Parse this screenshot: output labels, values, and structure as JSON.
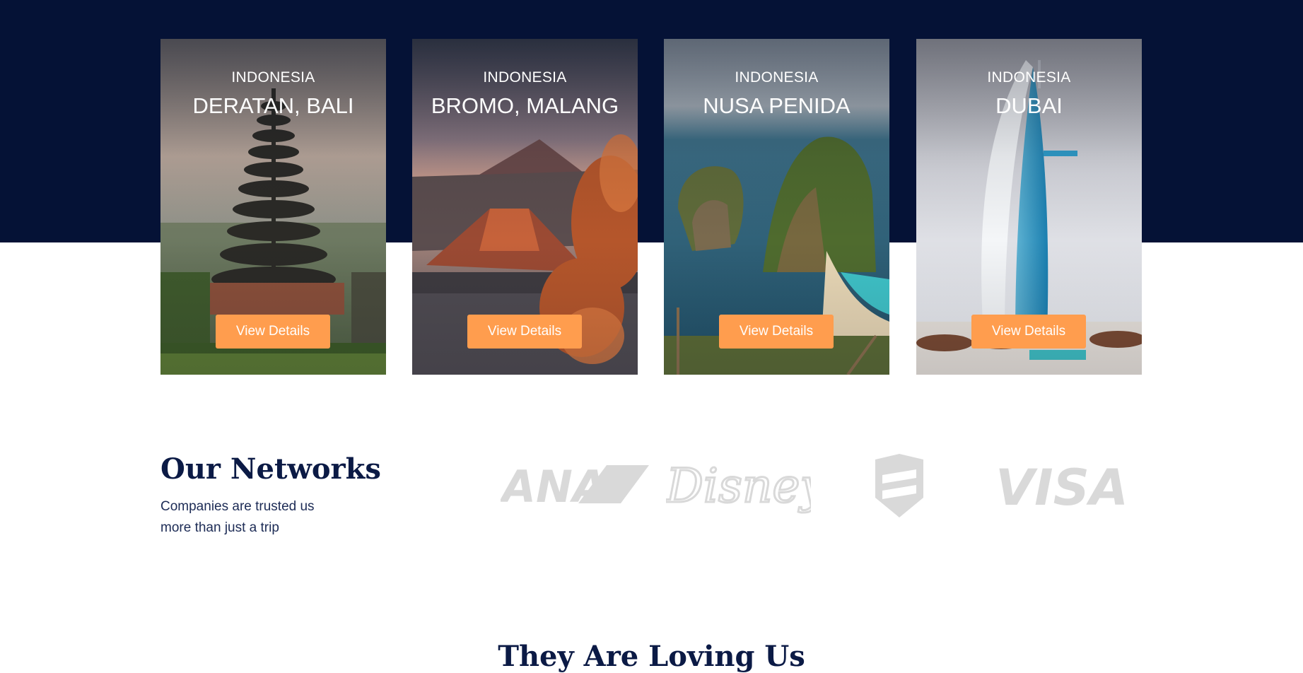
{
  "destinations": [
    {
      "country": "INDONESIA",
      "place": "DERATAN, BALI",
      "button": "View Details"
    },
    {
      "country": "INDONESIA",
      "place": "BROMO, MALANG",
      "button": "View Details"
    },
    {
      "country": "INDONESIA",
      "place": "NUSA PENIDA",
      "button": "View Details"
    },
    {
      "country": "INDONESIA",
      "place": "DUBAI",
      "button": "View Details"
    }
  ],
  "networks": {
    "title": "Our Networks",
    "subtitle": "Companies are trusted us more than just a trip",
    "logos": [
      {
        "name": "ana-logo",
        "text": "ANA"
      },
      {
        "name": "disney-logo",
        "text": "Disney"
      },
      {
        "name": "shield-logo",
        "text": ""
      },
      {
        "name": "visa-logo",
        "text": "VISA"
      }
    ]
  },
  "testimonials": {
    "title": "They Are Loving Us"
  },
  "colors": {
    "navy": "#051236",
    "accent": "#FF9D4E",
    "heading": "#0B1A45",
    "logo_gray": "#D9D9D9"
  }
}
